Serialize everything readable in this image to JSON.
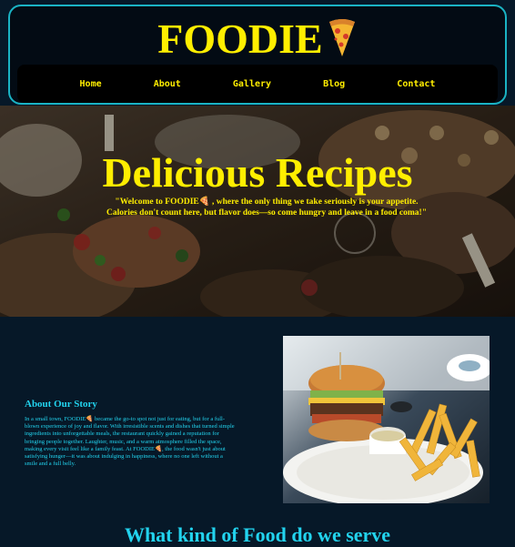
{
  "header": {
    "brand": "FOODIE",
    "brand_icon": "pizza-icon",
    "nav": [
      "Home",
      "About",
      "Gallery",
      "Blog",
      "Contact"
    ]
  },
  "hero": {
    "title": "Delicious Recipes",
    "quote": "\"Welcome to FOODIE🍕 , where the only thing we take seriously is your appetite. Calories don't count here, but flavor does—so come hungry and leave in a food coma!\""
  },
  "about": {
    "title": "About Our Story",
    "text": "In a small town, FOODIE🍕 became the go-to spot not just for eating, but for a full-blown experience of joy and flavor. With irresistible scents and dishes that turned simple ingredients into unforgettable meals, the restaurant quickly gained a reputation for bringing people together. Laughter, music, and a warm atmosphere filled the space, making every visit feel like a family feast. At FOODIE🍕, the food wasn't just about satisfying hunger—it was about indulging in happiness, where no one left without a smile and a full belly."
  },
  "section": {
    "title": "What kind of Food do we serve"
  },
  "colors": {
    "accent_yellow": "#ffee00",
    "accent_cyan": "#22d3ee",
    "background": "#061828"
  }
}
